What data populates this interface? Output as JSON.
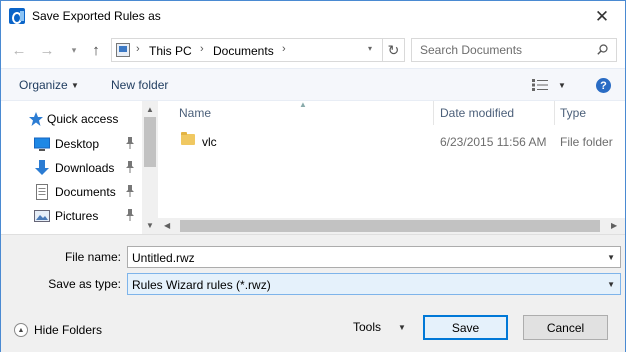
{
  "window": {
    "title": "Save Exported Rules as"
  },
  "nav": {
    "breadcrumbs": [
      "This PC",
      "Documents"
    ],
    "search_placeholder": "Search Documents"
  },
  "toolbar": {
    "organize_label": "Organize",
    "new_folder_label": "New folder"
  },
  "navpane": {
    "items": [
      {
        "label": "Quick access",
        "icon": "star-icon",
        "pinned": false
      },
      {
        "label": "Desktop",
        "icon": "desktop-icon",
        "pinned": true
      },
      {
        "label": "Downloads",
        "icon": "download-icon",
        "pinned": true
      },
      {
        "label": "Documents",
        "icon": "documents-icon",
        "pinned": true
      },
      {
        "label": "Pictures",
        "icon": "pictures-icon",
        "pinned": true
      }
    ]
  },
  "filelist": {
    "columns": [
      "Name",
      "Date modified",
      "Type"
    ],
    "rows": [
      {
        "name": "vlc",
        "date_modified": "6/23/2015 11:56 AM",
        "type": "File folder"
      }
    ]
  },
  "form": {
    "file_name_label": "File name:",
    "file_name_value": "Untitled.rwz",
    "save_as_type_label": "Save as type:",
    "save_as_type_value": "Rules Wizard rules (*.rwz)"
  },
  "footer": {
    "hide_folders_label": "Hide Folders",
    "tools_label": "Tools",
    "save_label": "Save",
    "cancel_label": "Cancel"
  },
  "colors": {
    "accent": "#0078d7",
    "window_border": "#4a8ad2",
    "toolbar_bg": "#f5f7fb",
    "folder": "#f0c861"
  }
}
